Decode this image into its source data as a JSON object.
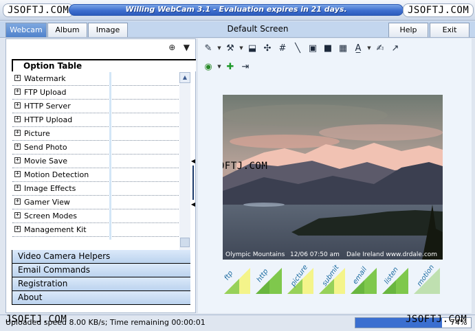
{
  "window": {
    "title": "Willing WebCam 3.1 - Evaluation expires in 21 days.",
    "watermark": "JSOFTJ.COM"
  },
  "menu": {
    "tabs": [
      {
        "label": "Webcam",
        "active": true
      },
      {
        "label": "Album",
        "active": false
      },
      {
        "label": "Image",
        "active": false
      }
    ],
    "screen_title": "Default Screen",
    "help": "Help",
    "exit": "Exit"
  },
  "left_panel": {
    "option_table": "Option Table",
    "options": [
      "Watermark",
      "FTP Upload",
      "HTTP Server",
      "HTTP Upload",
      "Picture",
      "Send Photo",
      "Movie Save",
      "Motion Detection",
      "Image Effects",
      "Gamer View",
      "Screen Modes",
      "Management Kit"
    ],
    "sections": [
      "Video Camera Helpers",
      "Email Commands",
      "Registration",
      "About"
    ]
  },
  "toolbar": {
    "icons": [
      "edit-text-icon",
      "tools-icon",
      "layout-icon",
      "move-icon",
      "grid-icon",
      "line-icon",
      "frame-icon",
      "camera-icon",
      "film-icon",
      "font-icon",
      "paint-icon",
      "export-icon"
    ],
    "row2_icons": [
      "globe-icon",
      "add-icon",
      "exit-door-icon"
    ]
  },
  "video": {
    "watermark": "JSOFTJ.COM",
    "caption_location": "Olympic Mountains",
    "caption_time": "12/06 07:50 am",
    "caption_credit": "Dale Ireland www.drdale.com"
  },
  "actions": [
    "ftp",
    "http",
    "picture",
    "submit",
    "email",
    "listen",
    "motion"
  ],
  "status": {
    "text": "Uploaded speed 8.00 KB/s; Time remaining 00:00:01",
    "watermark": "JSOFTJ.COM",
    "progress": 0.75,
    "progress_label": "74%"
  },
  "colors": {
    "accent": "#3b6fd0",
    "panel": "#c3d6ee",
    "action_green": "#7fc84c",
    "action_yellow": "#f4f48a"
  }
}
